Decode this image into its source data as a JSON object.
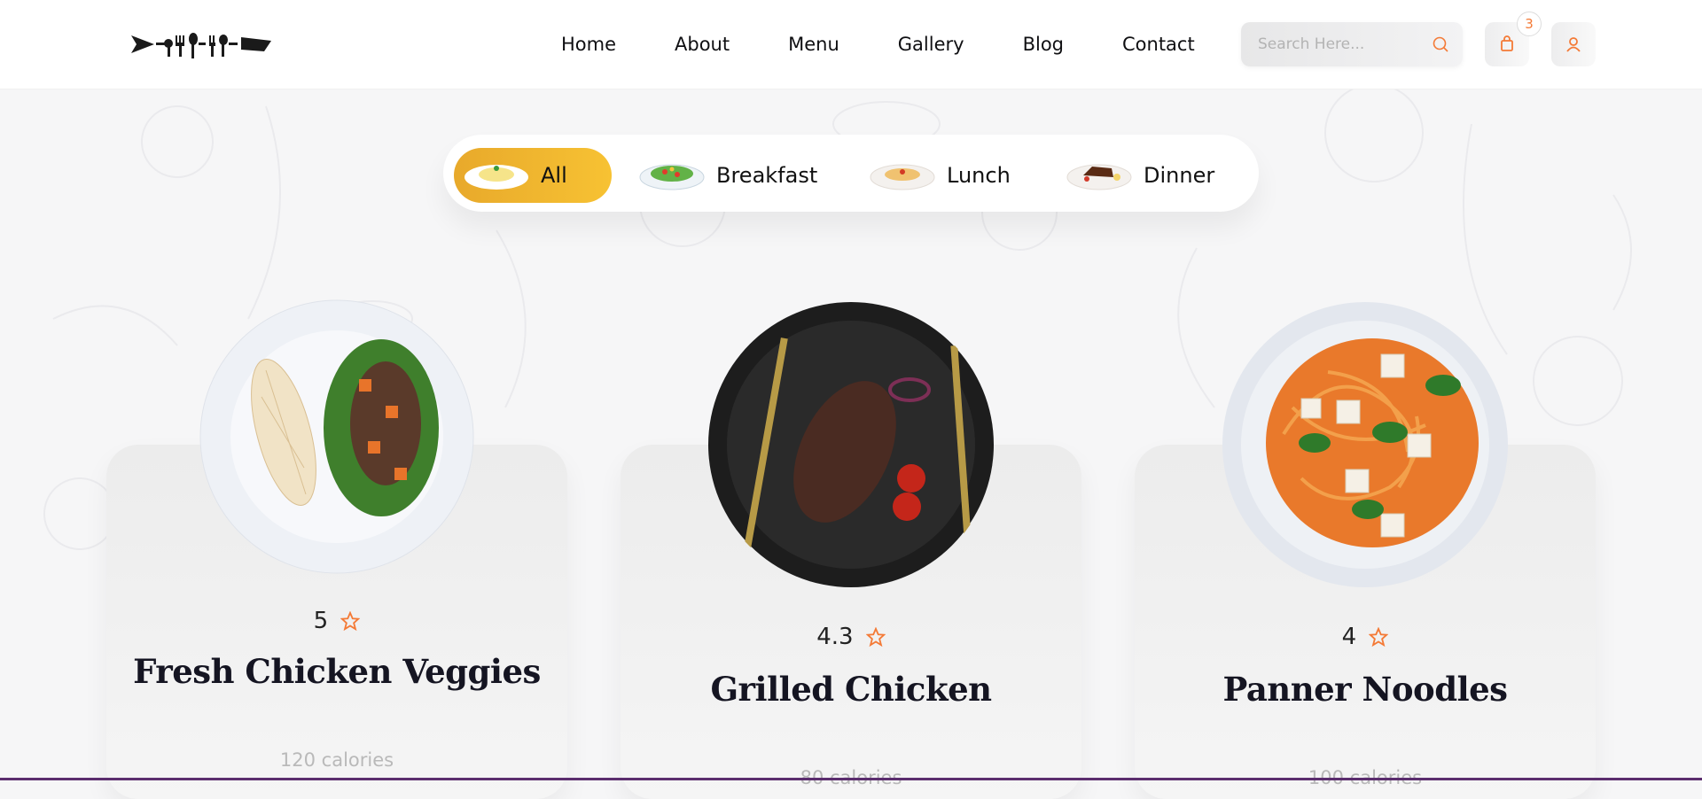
{
  "header": {
    "nav": [
      "Home",
      "About",
      "Menu",
      "Gallery",
      "Blog",
      "Contact"
    ],
    "search_placeholder": "Search Here...",
    "cart_count": "3",
    "icons": [
      "logo-cutlery",
      "search-icon",
      "bag-icon",
      "user-icon"
    ]
  },
  "filters": [
    "All",
    "Breakfast",
    "Lunch",
    "Dinner"
  ],
  "active_filter": "All",
  "cards": [
    {
      "rating": "5",
      "title": "Fresh Chicken Veggies",
      "calories": "120 calories"
    },
    {
      "rating": "4.3",
      "title": "Grilled Chicken",
      "calories": "80 calories"
    },
    {
      "rating": "4",
      "title": "Panner Noodles",
      "calories": "100 calories"
    }
  ],
  "colors": {
    "accent": "#f47a36",
    "active_pill": "#f7c233",
    "title": "#151522",
    "bottom_bar": "#5b2d6e"
  }
}
